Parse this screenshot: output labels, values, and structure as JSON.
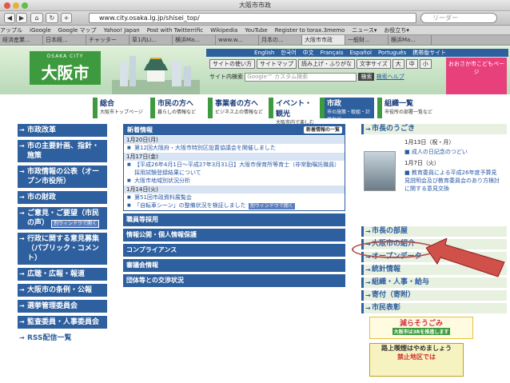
{
  "window": {
    "title": "大阪市市政"
  },
  "toolbar": {
    "url": "www.city.osaka.lg.jp/shisei_top/",
    "search_placeholder": "リーダー",
    "back": "◀",
    "forward": "▶",
    "plus": "+"
  },
  "bookmarks": [
    "アップル",
    "iGoogle",
    "Google マップ",
    "Yahoo! Japan",
    "Post with Twitterrific",
    "Wikipedia",
    "YouTube",
    "Register to torax.3memo",
    "ニュース▾",
    "お役立ち▾"
  ],
  "tabs": [
    "経済産業...",
    "日本経...",
    "チャッター",
    "草1内Li...",
    "横浜Ma...",
    "www.w...",
    "月本の...",
    "大阪市市政",
    "一般財...",
    "横浜Ma..."
  ],
  "header": {
    "logo_en": "OSAKA CITY",
    "logo_jp": "大阪市",
    "languages": [
      "English",
      "한국어",
      "中文",
      "Français",
      "Español",
      "Português",
      "携帯版サイト"
    ],
    "util_buttons": [
      "サイトの使い方",
      "サイトマップ",
      "読み上げ・ふりがな",
      "文字サイズ",
      "大",
      "中",
      "小"
    ],
    "site_search_label": "サイト内検索",
    "search_placeholder": "Google™ カスタム検索",
    "search_button": "検索",
    "help": "検索ヘルプ",
    "kids_banner": "おおさか市こどもページ"
  },
  "nav": [
    {
      "label": "総合",
      "sub": "大阪市トップページ"
    },
    {
      "label": "市民の方へ",
      "sub": "暮らしの情報など"
    },
    {
      "label": "事業者の方へ",
      "sub": "ビジネス上の情報など"
    },
    {
      "label": "イベント・観光",
      "sub": "大阪市内で楽しむ情報"
    },
    {
      "label": "市政",
      "sub": "市の施策・取組・計画など"
    },
    {
      "label": "組織一覧",
      "sub": "市役所の部署一覧など"
    }
  ],
  "leftnav": [
    {
      "label": "市政改革",
      "badge": ""
    },
    {
      "label": "市の主要計画、指針・施策",
      "badge": ""
    },
    {
      "label": "市政情報の公表（オープン市役所）",
      "badge": ""
    },
    {
      "label": "市の財政",
      "badge": ""
    },
    {
      "label": "ご意見・ご要望（市民の声）",
      "badge": "別ウィンドウで開く"
    },
    {
      "label": "行政に関する意見募集（パブリック・コメント）",
      "badge": ""
    },
    {
      "label": "広聴・広報・報道",
      "badge": ""
    },
    {
      "label": "大阪市の条例・公報",
      "badge": ""
    },
    {
      "label": "選挙管理委員会",
      "badge": ""
    },
    {
      "label": "監査委員・人事委員会",
      "badge": ""
    },
    {
      "label": "RSS配信一覧",
      "badge": ""
    }
  ],
  "news": {
    "title": "新着情報",
    "all_button": "新着情報の一覧",
    "groups": [
      {
        "date": "1月20日(月)",
        "items": [
          "第12回大阪府・大阪市特別区設置協議会を開催しました"
        ]
      },
      {
        "date": "1月17日(金)",
        "items": [
          "【平成26年4月1日〜平成27年3月31日】大阪市保育所等育士（非常勤嘱託職員）採用試験登録結果について",
          "大阪市地域別状況分析"
        ]
      },
      {
        "date": "1月14日(火)",
        "items": [
          "第51回市政資料展覧会",
          "「自転車シーン」の整備状況を検証しました"
        ]
      }
    ],
    "window_badge": "別ウィンドウで開く"
  },
  "sections": [
    "職員等採用",
    "情報公開・個人情報保護",
    "コンプライアンス",
    "審議会情報",
    "団体等との交渉状況"
  ],
  "right": {
    "mayor_title": "市長のうごき",
    "mayor_lines": [
      "1月13日（祝・月）",
      "■ 成人の日記念のつどい",
      "1月7日（火）",
      "■ 教育委員による平成26年度予算見見説明会及び教育委員会のあり方検討に関する意見交換"
    ],
    "links": [
      "市長の部屋",
      "大阪市の紹介",
      "オープンデータ",
      "統計情報",
      "組織・人事・給与",
      "寄付（寄附）",
      "市民表彰"
    ],
    "banner1": "減らそうごみ",
    "banner1_sub": "大阪市は3Rを推進します",
    "banner2_line1": "路上喫煙はやめましょう",
    "banner2_line2": "禁止地区では"
  }
}
